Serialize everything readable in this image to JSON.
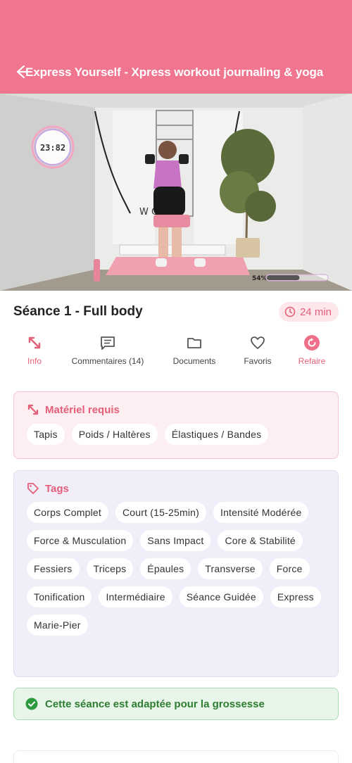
{
  "header": {
    "title": "Express Yourself - Xpress workout journaling & yoga",
    "background": "#f0758f"
  },
  "video": {
    "timer": "23:82",
    "wall_text": "W     CY",
    "progress_text": "54%",
    "progress_fraction": 0.54
  },
  "workout": {
    "title": "Séance 1 - Full body",
    "duration": "24 min"
  },
  "tabs": [
    {
      "label": "Info",
      "icon": "expand-arrows-icon",
      "active": true
    },
    {
      "label": "Commentaires (14)",
      "icon": "comment-icon",
      "active": false
    },
    {
      "label": "Documents",
      "icon": "folder-icon",
      "active": false
    },
    {
      "label": "Favoris",
      "icon": "heart-icon",
      "active": false
    },
    {
      "label": "Refaire",
      "icon": "redo-icon",
      "active": true
    }
  ],
  "equipment": {
    "title": "Matériel requis",
    "items": [
      "Tapis",
      "Poids / Haltères",
      "Élastiques / Bandes"
    ]
  },
  "tags": {
    "title": "Tags",
    "items": [
      "Corps Complet",
      "Court (15-25min)",
      "Intensité Modérée",
      "Force & Musculation",
      "Sans Impact",
      "Core & Stabilité",
      "Fessiers",
      "Triceps",
      "Épaules",
      "Transverse",
      "Force",
      "Tonification",
      "Intermédiaire",
      "Séance Guidée",
      "Express",
      "Marie-Pier"
    ]
  },
  "pregnancy": {
    "text": "Cette séance est adaptée pour la grossesse"
  },
  "colors": {
    "accent": "#e45f79",
    "success": "#2e7d32",
    "equipment_bg": "#fdeef1",
    "tags_bg": "#f1eef9"
  }
}
